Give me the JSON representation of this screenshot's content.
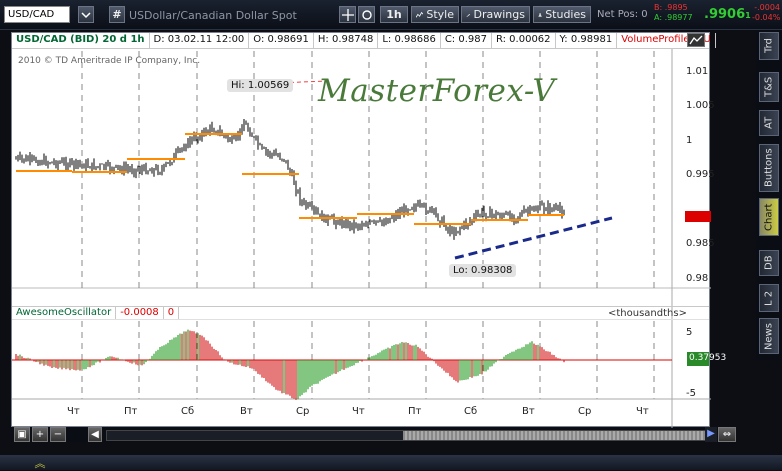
{
  "toolbar": {
    "symbol": "USD/CAD",
    "description": "USDollar/Canadian Dollar Spot",
    "period": "1h",
    "style_label": "Style",
    "drawings_label": "Drawings",
    "studies_label": "Studies",
    "netpos_label": "Net Pos: 0",
    "bid_label": "B:",
    "bid_value": ".9895",
    "ask_label": "A:",
    "ask_value": ".98977",
    "last_main": ".9906",
    "last_small": "1",
    "change1": "-.0004",
    "change2": "-0.04%"
  },
  "right_tabs": [
    "Trd",
    "T&S",
    "AT",
    "Buttons",
    "Chart",
    "DB",
    "L 2",
    "News"
  ],
  "active_tab": "Chart",
  "chart": {
    "header": {
      "symbol_period": "USD/CAD (BID) 20 d 1h",
      "date": "D: 03.02.11 12:00",
      "open": "O: 0.98691",
      "high": "H: 0.98748",
      "low": "L: 0.98686",
      "close": "C: 0.987",
      "range": "R: 0.00062",
      "yval": "Y: 0.98981",
      "study": "VolumeProfile (AU"
    },
    "copyright": "2010 © TD Ameritrade IP Company, Inc.",
    "watermark": "MasterForex-V",
    "hi_label": "Hi: 1.00569",
    "lo_label": "Lo: 0.98308",
    "y_ticks": [
      "1.01",
      "1.005",
      "1",
      "0.995",
      "0.99",
      "0.985",
      "0.98"
    ],
    "oscillator": {
      "name": "AwesomeOscillator",
      "value": "-0.0008",
      "zero": "0",
      "units": "<thousandths>",
      "ticks": [
        "5",
        "-5"
      ],
      "current": "0.37953"
    },
    "x_labels": [
      "Чт",
      "Пт",
      "Сб",
      "Вт",
      "Ср",
      "Чт",
      "Пт",
      "Сб",
      "Вт",
      "Ср",
      "Чт"
    ]
  },
  "colors": {
    "up": "#2fa02f",
    "down": "#d42020",
    "profile": "#ff8c00",
    "trend": "#1a2a8a",
    "accent_green": "#3c3"
  }
}
